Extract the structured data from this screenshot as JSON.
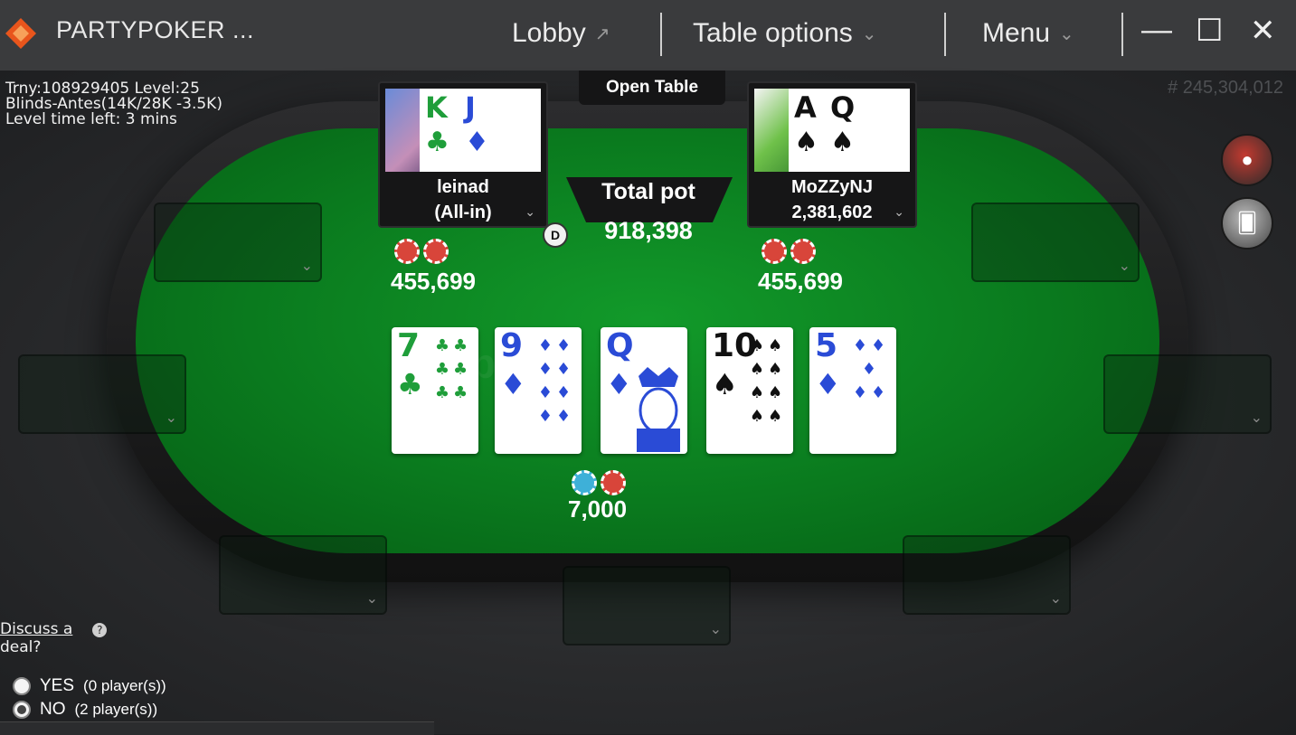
{
  "titlebar": {
    "app_title": "PARTYPOKER ...",
    "lobby": "Lobby",
    "lobby_icon": "external-arrow-icon",
    "table_options": "Table options",
    "menu": "Menu",
    "minimize": "—",
    "maximize": "☐",
    "close": "✕"
  },
  "info": {
    "line1": "Trny:108929405 Level:25",
    "line2": "Blinds-Antes(14K/28K -3.5K)",
    "line3": "Level time left: 3 mins",
    "hand_id": "# 245,304,012"
  },
  "open_table": "Open Table",
  "pot": {
    "label": "Total pot",
    "value": "918,398"
  },
  "dealer": "D",
  "players": [
    {
      "name": "leinad",
      "stack": "(All-in)",
      "cards": [
        {
          "rank": "K",
          "suit": "♣",
          "color": "#1f9e3a"
        },
        {
          "rank": "J",
          "suit": "♦",
          "color": "#2a4bd6"
        }
      ],
      "bet": "455,699"
    },
    {
      "name": "MoZZyNJ",
      "stack": "2,381,602",
      "cards": [
        {
          "rank": "A",
          "suit": "♠",
          "color": "#111111"
        },
        {
          "rank": "Q",
          "suit": "♠",
          "color": "#111111"
        }
      ],
      "bet": "455,699"
    }
  ],
  "board": [
    {
      "rank": "7",
      "suit": "♣",
      "color": "#1f9e3a",
      "pips": "♣♣ ♣♣ ♣♣"
    },
    {
      "rank": "9",
      "suit": "♦",
      "color": "#2a4bd6",
      "pips": "♦♦ ♦♦ ♦♦ ♦♦"
    },
    {
      "rank": "Q",
      "suit": "♦",
      "color": "#2a4bd6",
      "pips": ""
    },
    {
      "rank": "10",
      "suit": "♠",
      "color": "#111111",
      "pips": "♠♠ ♠♠ ♠♠ ♠♠"
    },
    {
      "rank": "5",
      "suit": "♦",
      "color": "#2a4bd6",
      "pips": "♦♦ ♦ ♦♦"
    }
  ],
  "center_bet": "7,000",
  "deal": {
    "prompt_line1": "Discuss a",
    "prompt_line2": "deal?",
    "yes": "YES",
    "yes_count": "(0 player(s))",
    "no": "NO",
    "no_count": "(2 player(s))"
  },
  "colors": {
    "felt": "#0a7a1e",
    "chip_red": "#d8453a",
    "chip_blue": "#3eb0d8",
    "logo": "#e8551c"
  }
}
